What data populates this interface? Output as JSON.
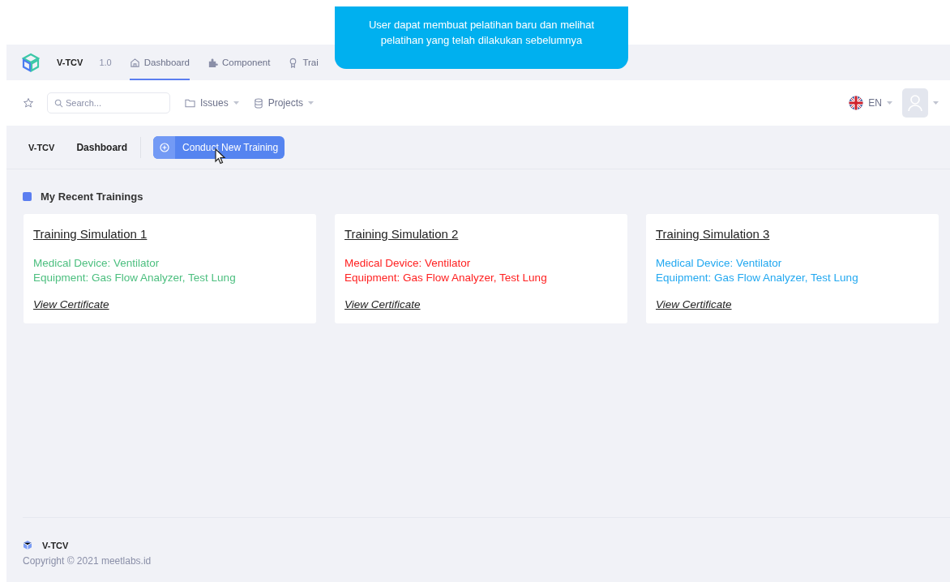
{
  "tooltip": {
    "text": "User dapat membuat pelatihan baru dan melihat pelatihan yang telah dilakukan sebelumnya"
  },
  "header": {
    "app_name": "V-TCV",
    "version": "1.0",
    "nav": [
      {
        "label": "Dashboard",
        "kind": "home",
        "selected": true
      },
      {
        "label": "Component",
        "kind": "puzzle",
        "selected": false
      },
      {
        "label": "Trai",
        "kind": "award",
        "selected": false
      }
    ]
  },
  "toolbar": {
    "search": {
      "placeholder": "Search..."
    },
    "menus": [
      {
        "label": "Issues",
        "kind": "folder"
      },
      {
        "label": "Projects",
        "kind": "database"
      }
    ],
    "language": "EN"
  },
  "breadcrumb": [
    "V-TCV",
    "Dashboard"
  ],
  "action_button": "Conduct New Training",
  "section_title": "My Recent Trainings",
  "trainings": [
    {
      "title": "Training Simulation 1",
      "device": "Medical Device: Ventilator",
      "equipment": "Equipment: Gas Flow Analyzer, Test Lung",
      "link": "View Certificate",
      "color": "#4cbf7f"
    },
    {
      "title": "Training Simulation 2",
      "device": "Medical Device: Ventilator",
      "equipment": "Equipment: Gas Flow Analyzer, Test Lung",
      "link": "View Certificate",
      "color": "#ff2020"
    },
    {
      "title": "Training Simulation 3",
      "device": "Medical Device: Ventilator",
      "equipment": "Equipment: Gas Flow Analyzer, Test Lung",
      "link": "View Certificate",
      "color": "#22a8f0"
    }
  ],
  "footer": {
    "app_name": "V-TCV",
    "copyright": "Copyright © 2021 meetlabs.id"
  }
}
